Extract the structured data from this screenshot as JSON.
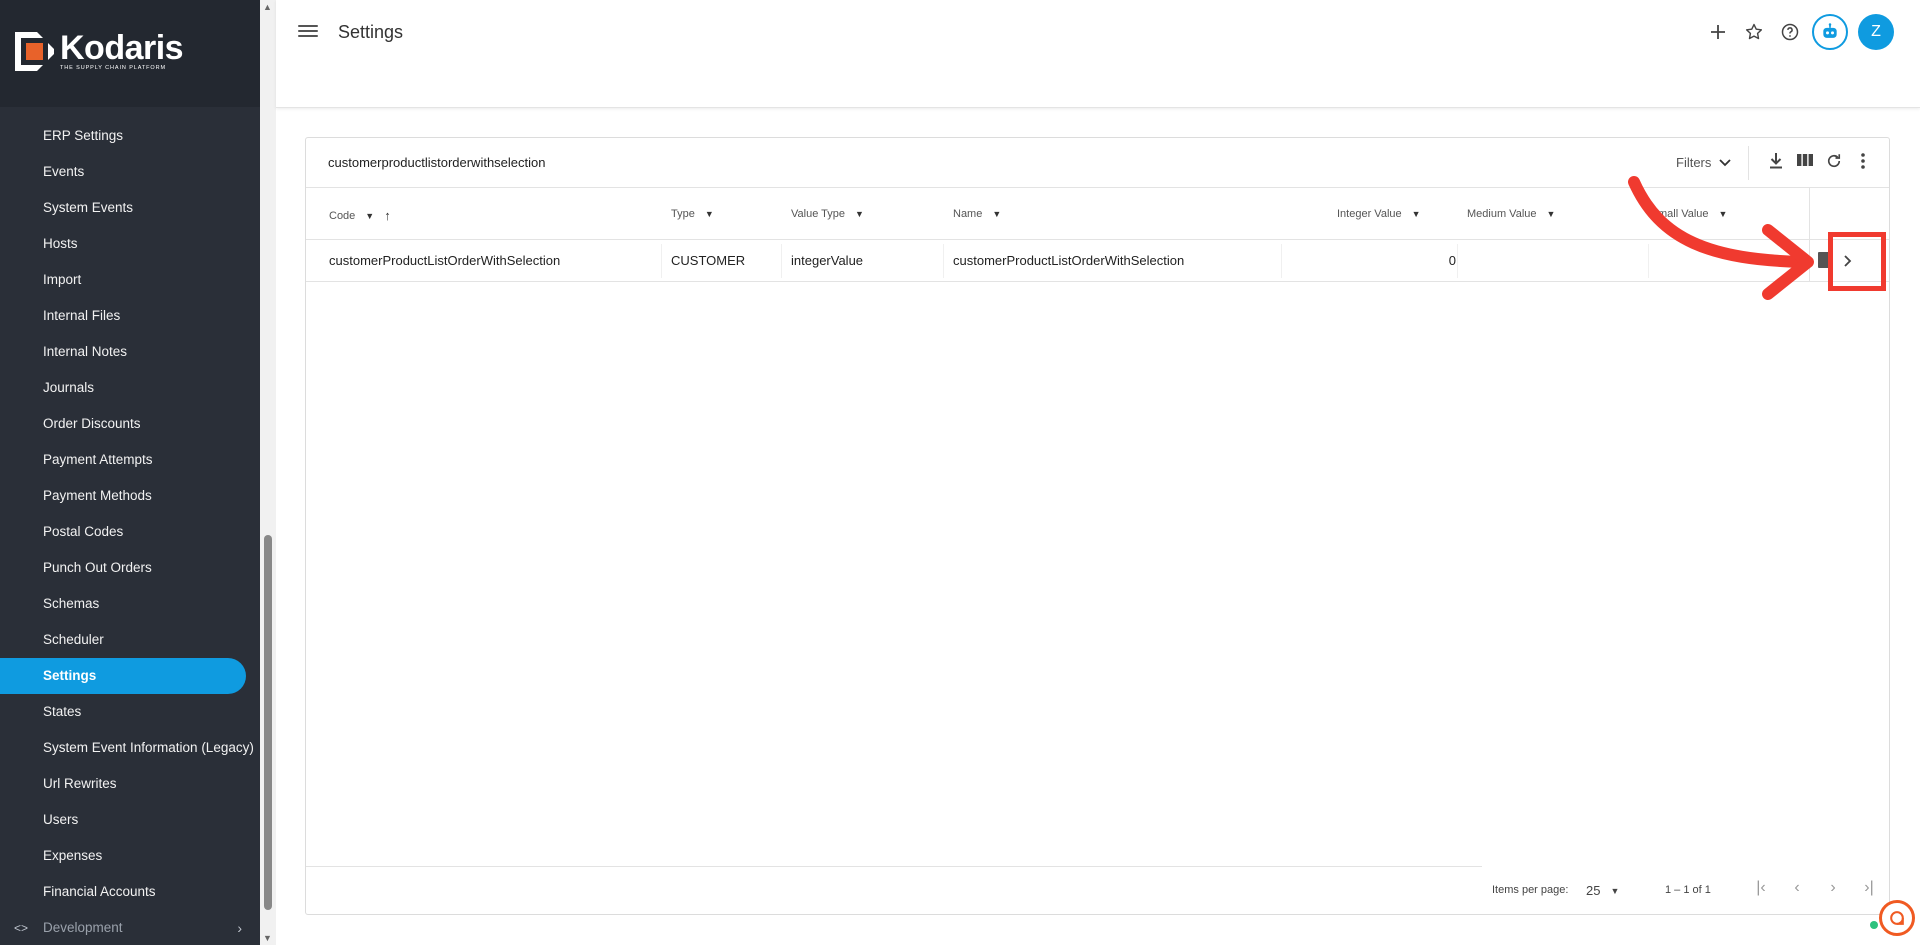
{
  "brand": {
    "name": "Kodaris",
    "tagline": "THE SUPPLY CHAIN PLATFORM",
    "accent": "#0f9be0",
    "sidebar_bg": "#2a2f38"
  },
  "sidebar": {
    "items": [
      {
        "label": "ERP Settings"
      },
      {
        "label": "Events"
      },
      {
        "label": "System Events"
      },
      {
        "label": "Hosts"
      },
      {
        "label": "Import"
      },
      {
        "label": "Internal Files"
      },
      {
        "label": "Internal Notes"
      },
      {
        "label": "Journals"
      },
      {
        "label": "Order Discounts"
      },
      {
        "label": "Payment Attempts"
      },
      {
        "label": "Payment Methods"
      },
      {
        "label": "Postal Codes"
      },
      {
        "label": "Punch Out Orders"
      },
      {
        "label": "Schemas"
      },
      {
        "label": "Scheduler"
      },
      {
        "label": "Settings",
        "active": true
      },
      {
        "label": "States"
      },
      {
        "label": "System Event Information (Legacy)"
      },
      {
        "label": "Url Rewrites"
      },
      {
        "label": "Users"
      },
      {
        "label": "Expenses"
      },
      {
        "label": "Financial Accounts"
      }
    ],
    "development": {
      "label": "Development",
      "icon": "code-icon"
    }
  },
  "header": {
    "title": "Settings",
    "actions": [
      "add-icon",
      "star-icon",
      "help-icon",
      "bot-icon"
    ],
    "avatar_initial": "Z"
  },
  "table": {
    "search_value": "customerproductlistorderwithselection",
    "filters_label": "Filters",
    "tools": [
      "download-icon",
      "columns-icon",
      "refresh-icon",
      "more-vert-icon"
    ],
    "columns": [
      {
        "label": "Code",
        "sorted": "asc"
      },
      {
        "label": "Type"
      },
      {
        "label": "Value Type"
      },
      {
        "label": "Name"
      },
      {
        "label": "Integer Value"
      },
      {
        "label": "Medium Value"
      },
      {
        "label": "mall Value"
      }
    ],
    "rows": [
      {
        "code": "customerProductListOrderWithSelection",
        "type": "CUSTOMER",
        "value_type": "integerValue",
        "name": "customerProductListOrderWithSelection",
        "integer_value": "0",
        "medium_value": "",
        "small_value": ""
      }
    ],
    "paginator": {
      "items_per_page_label": "Items per page:",
      "page_size": "25",
      "range_label": "1 – 1 of 1"
    }
  },
  "annotation": {
    "color": "#f03a2f"
  }
}
